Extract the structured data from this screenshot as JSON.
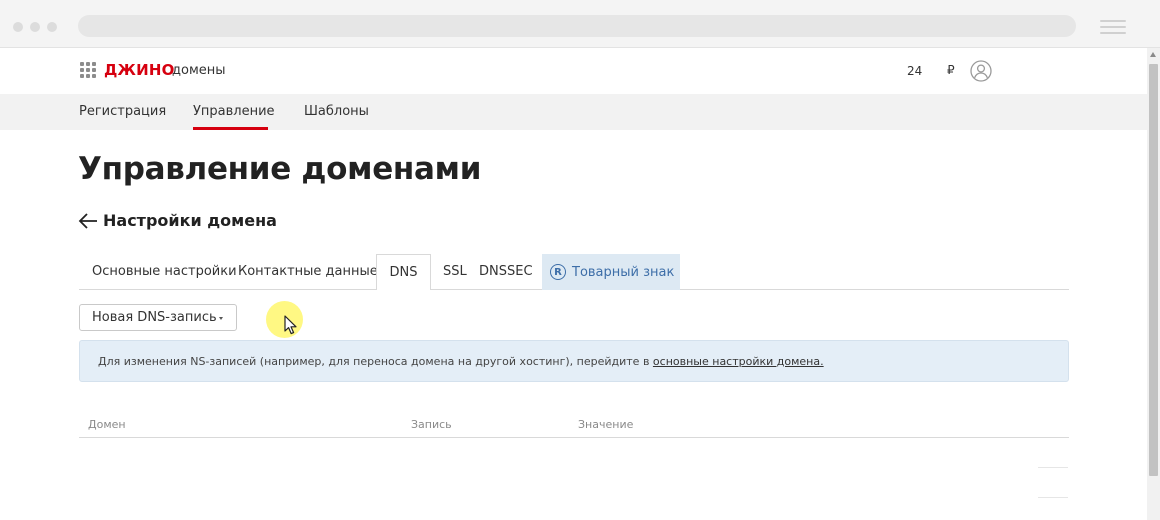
{
  "header": {
    "brand": "ДЖИНО",
    "section": "домены",
    "balance": "24",
    "currency": "₽"
  },
  "nav": {
    "items": [
      {
        "label": "Регистрация"
      },
      {
        "label": "Управление",
        "active": true
      },
      {
        "label": "Шаблоны"
      }
    ]
  },
  "main": {
    "title": "Управление доменами",
    "back_label": "Настройки домена",
    "tabs": [
      {
        "label": "Основные настройки"
      },
      {
        "label": "Контактные данные"
      },
      {
        "label": "DNS",
        "active": true
      },
      {
        "label": "SSL"
      },
      {
        "label": "DNSSEC"
      },
      {
        "label": "Товарный знак",
        "icon": "registered-trademark-icon"
      }
    ],
    "dns_button": "Новая DNS-запись",
    "info": {
      "text": "Для изменения NS-записей (например, для переноса домена на другой хостинг), перейдите в ",
      "link": "основные настройки домена."
    },
    "table": {
      "columns": [
        "Домен",
        "Запись",
        "Значение"
      ]
    }
  },
  "colors": {
    "brand": "#d6000f",
    "accent_blue": "#3d6ea8",
    "info_bg": "#e4eef7",
    "nav_bg": "#f2f2f2"
  }
}
